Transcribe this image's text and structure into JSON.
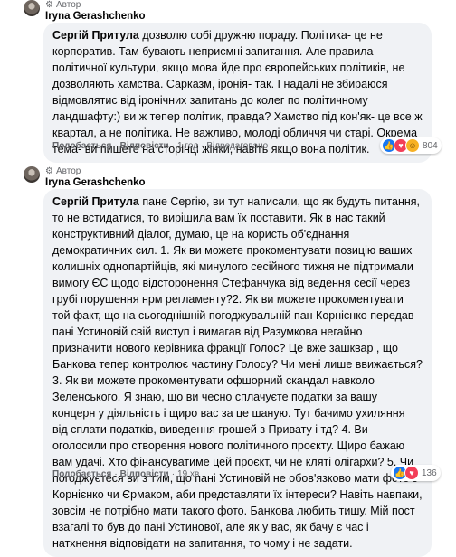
{
  "comments": [
    {
      "author_badge": "Автор",
      "author": "Iryna Gerashchenko",
      "mention": "Сергій Притула",
      "text": " дозволю собі дружню пораду. Політика- це не корпоратив. Там бувають неприємні запитання. Але правила політичної культури, якщо мова йде про європейських політиків, не дозволяють хамства. Сарказм, іронія- так. І надалі не збираюся відмовлятис від іронічних запитань до колег по політичному ландшафту:) ви ж тепер політик, правда? Хамство під кон'як- це все ж квартал, а не політика. Не важливо, молоді обличчя чи старі. Окрема тема- ви пишете на сторінці жінки, навіть якщо вона політик.",
      "like_label": "Подобається",
      "reply_label": "Відповісти",
      "time": "1 год",
      "edited": "Відредаговано",
      "reaction_count": "804"
    },
    {
      "author_badge": "Автор",
      "author": "Iryna Gerashchenko",
      "mention": "Сергій Притула",
      "text": " пане Сергію, ви тут написали, що як будуть питання, то не встидатися, то вирішила вам їх поставити. Як в нас такий конструктивний діалог, думаю, це на користь об'єднання демократичних сил. 1. Як ви можете прокоментувати позицію ваших колишніх однопартійців, які минулого сесійного тижня не підтримали вимогу ЄС щодо відсторонення Стефанчука від ведення сесії через грубі порушення нрм регламенту?2. Як ви можете прокоментувати той факт, що на сьогоднішній погоджувальній пан Корнієнко передав пані Устиновій свій виступ і вимагав від Разумкова негайно призначити нового керівника фракції Голос? Це вже зашквар , що Банкова тепер контролює частину Голосу? Чи мені лише ввижається?3. Як ви можете прокоментувати офшорний скандал навколо Зеленського. Я знаю, що ви чесно сплачуєте податки за вашу концерн у діяльність і щиро вас за це шаную. Тут бачимо ухиляння від сплати податків, виведення грошей з Привату і тд? 4. Ви оголосили про створення нового політичного проєкту. Щиро бажаю вам удачі. Хто фінансуватиме цей проєкт, чи не кляті олігархи? 5. Чи погоджуєтеся ви з тим, що пані Устиновій не обов'язково мати фото з Корнієнко чи Єрмаком, аби представляти їх інтереси? Навіть навпаки, зовсім не потрібно мати такого фото. Банкова любить тишу. Мій пост взагалі то був до пані Устинової, але як у вас, як бачу є час і натхнення відповідати на запитання, то чому і не задати.",
      "like_label": "Подобається",
      "reply_label": "Відповісти",
      "time": "19 хв",
      "reaction_count": "136"
    }
  ],
  "icons": {
    "badge": "gear-icon",
    "reactions": [
      "like-icon",
      "love-icon",
      "haha-icon"
    ]
  },
  "colors": {
    "bubble": "#f0f2f5",
    "like": "#1877f2",
    "love": "#f33e58",
    "haha": "#f7b125"
  }
}
